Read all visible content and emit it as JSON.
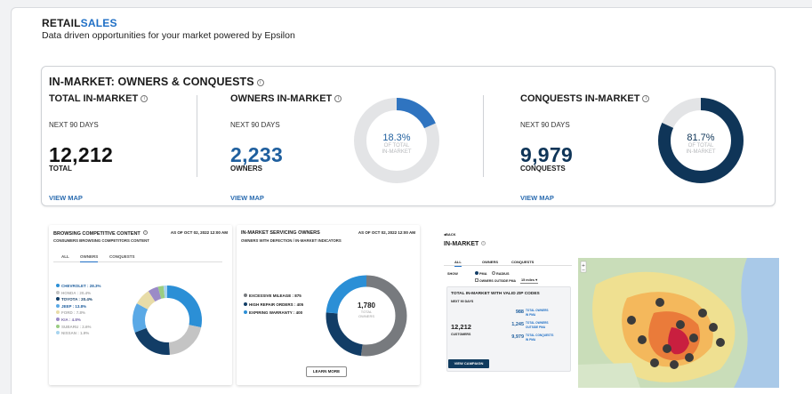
{
  "header": {
    "brand_part1": "RETAIL",
    "brand_part2": "SALES",
    "subtitle": "Data driven opportunities for your market powered by Epsilon"
  },
  "in_market": {
    "title": "IN-MARKET: OWNERS & CONQUESTS",
    "total": {
      "title": "TOTAL IN-MARKET",
      "period": "NEXT 90 DAYS",
      "value": "12,212",
      "unit": "TOTAL",
      "link": "VIEW MAP"
    },
    "owners": {
      "title": "OWNERS IN-MARKET",
      "period": "NEXT 90 DAYS",
      "value": "2,233",
      "unit": "OWNERS",
      "link": "VIEW MAP",
      "pct": "18.3%",
      "of_total_1": "OF TOTAL",
      "of_total_2": "IN-MARKET",
      "share": 0.183
    },
    "conquests": {
      "title": "CONQUESTS IN-MARKET",
      "period": "NEXT 90 DAYS",
      "value": "9,979",
      "unit": "CONQUESTS",
      "link": "VIEW MAP",
      "pct": "81.7%",
      "of_total_1": "OF TOTAL",
      "of_total_2": "IN-MARKET",
      "share": 0.817
    }
  },
  "browsing": {
    "title": "BROWSING COMPETITIVE CONTENT",
    "as_of": "AS OF OCT 02, 2022 12:00 AM",
    "subtitle": "CONSUMERS BROWSING COMPETITORS CONTENT",
    "tabs": [
      "ALL",
      "OWNERS",
      "CONQUESTS"
    ],
    "legend": [
      {
        "label": "CHEVROLET : 28.3%",
        "color": "#2b8fd6",
        "value": 28.3
      },
      {
        "label": "HONDA : 20.4%",
        "color": "#c4c4c4",
        "value": 20.4
      },
      {
        "label": "TOYOTA : 20.4%",
        "color": "#123d66",
        "value": 20.4
      },
      {
        "label": "JEEP : 13.8%",
        "color": "#5aa9e6",
        "value": 13.8
      },
      {
        "label": "FORD : 7.8%",
        "color": "#e8dca8",
        "value": 7.8
      },
      {
        "label": "KIA : 4.8%",
        "color": "#9b8bc7",
        "value": 4.8
      },
      {
        "label": "SUBARU : 2.6%",
        "color": "#9acd82",
        "value": 2.6
      },
      {
        "label": "NISSAN : 1.9%",
        "color": "#a8d4ef",
        "value": 1.9
      }
    ]
  },
  "servicing": {
    "title": "IN-MARKET SERVICING OWNERS",
    "as_of": "AS OF OCT 02, 2022 12:00 AM",
    "subtitle": "OWNERS WITH DEFECTION / IN-MARKET INDICATORS",
    "legend": [
      {
        "label": "EXCESSIVE MILEAGE : 875",
        "color": "#777a7e",
        "value": 875
      },
      {
        "label": "HIGH REPAIR ORDERS : 405",
        "color": "#123d66",
        "value": 405
      },
      {
        "label": "EXPIRING WARRANTY : 400",
        "color": "#2b8fd6",
        "value": 400
      }
    ],
    "center_value": "1,780",
    "center_label_1": "TOTAL",
    "center_label_2": "OWNERS",
    "button": "LEARN MORE"
  },
  "map_card": {
    "back": "BACK",
    "title": "IN-MARKET",
    "tabs": [
      "ALL",
      "OWNERS",
      "CONQUESTS"
    ],
    "show_label": "SHOW",
    "radio_pma": "PMA",
    "radio_radius": "RADIUS",
    "checkbox_label": "OWNERS OUTSIDE PMA",
    "miles": "15 miles",
    "box_title": "TOTAL IN-MARKET WITH VALID ZIP CODES",
    "box_period": "NEXT 90 DAYS",
    "total_value": "12,212",
    "total_label": "CUSTOMERS",
    "rows": [
      {
        "value": "988",
        "label_1": "TOTAL OWNERS",
        "label_2": "IN PMA"
      },
      {
        "value": "1,245",
        "label_1": "TOTAL OWNERS",
        "label_2": "OUTSIDE PMA"
      },
      {
        "value": "9,979",
        "label_1": "TOTAL CONQUESTS",
        "label_2": "IN PMA"
      }
    ],
    "button": "VIEW CAMPAIGN"
  },
  "colors": {
    "accent": "#1f6fc5",
    "owners_blue": "#2f74c0",
    "conquest_navy": "#0f3558",
    "ring_grey": "#e3e4e6"
  }
}
